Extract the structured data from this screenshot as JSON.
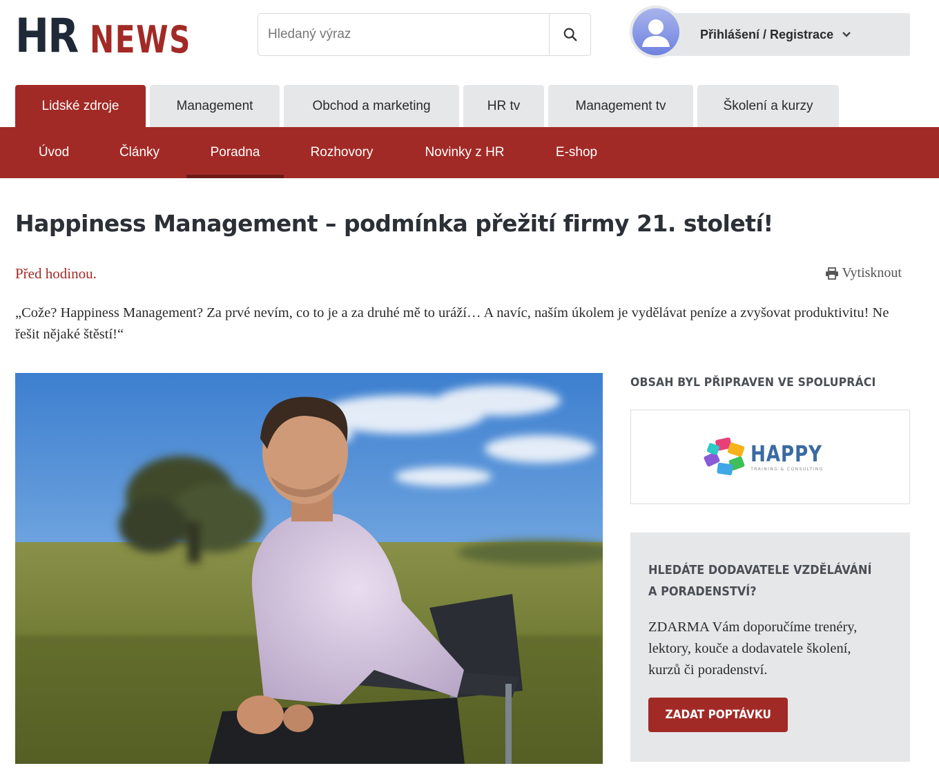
{
  "header": {
    "logo": {
      "part1": "HR",
      "part2": "NEWS"
    },
    "search": {
      "placeholder": "Hledaný výraz",
      "icon": "search-icon"
    },
    "user": {
      "label": "Přihlášení / Registrace",
      "icon": "avatar-icon"
    }
  },
  "tabs": [
    {
      "label": "Lidské zdroje",
      "active": true
    },
    {
      "label": "Management"
    },
    {
      "label": "Obchod a marketing"
    },
    {
      "label": "HR tv"
    },
    {
      "label": "Management tv"
    },
    {
      "label": "Školení a kurzy"
    }
  ],
  "subnav": [
    {
      "label": "Úvod"
    },
    {
      "label": "Články"
    },
    {
      "label": "Poradna",
      "active": true
    },
    {
      "label": "Rozhovory"
    },
    {
      "label": "Novinky z HR"
    },
    {
      "label": "E-shop"
    }
  ],
  "article": {
    "title": "Happiness Management – podmínka přežití firmy 21. století!",
    "date": "Před hodinou.",
    "print_label": "Vytisknout",
    "lead": "„Cože? Happiness Management? Za prvé nevím, co to je a za druhé mě to uráží… A navíc, naším úkolem je vydělávat peníze a zvyšovat produktivitu! Ne řešit nějaké štěstí!“"
  },
  "sidebar": {
    "partner_label": "OBSAH BYL PŘIPRAVEN VE SPOLUPRÁCI",
    "partner": {
      "name": "HAPPY",
      "tagline": "TRAINING & CONSULTING"
    },
    "promo": {
      "heading": "HLEDÁTE DODAVATELE VZDĚLÁVÁNÍ A PORADENSTVÍ?",
      "text": "ZDARMA Vám doporučíme trenéry, lektory, kouče a dodavatele školení, kurzů či poradenství.",
      "button": "ZADAT POPTÁVKU"
    }
  },
  "colors": {
    "brand_red": "#a22a26",
    "tab_gray": "#e6e7e9",
    "dark_text": "#2b2f36"
  }
}
